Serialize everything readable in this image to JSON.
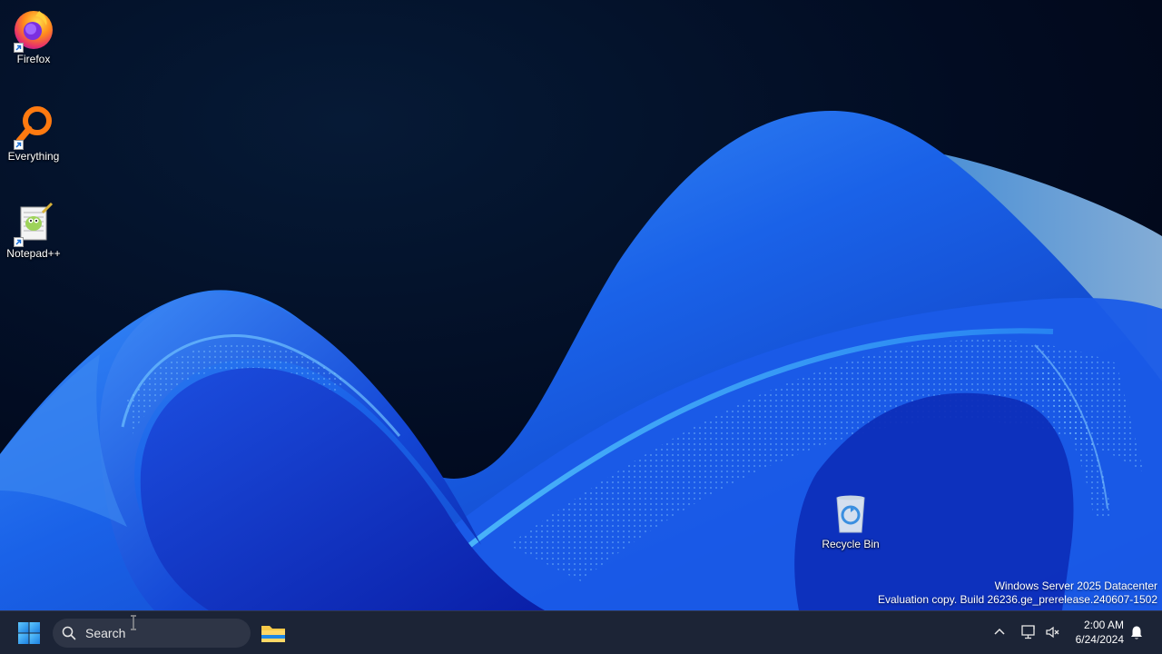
{
  "desktop": {
    "icons": [
      {
        "label": "Firefox",
        "icon": "firefox-icon"
      },
      {
        "label": "Everything",
        "icon": "everything-search-icon"
      },
      {
        "label": "Notepad++",
        "icon": "notepad-plus-plus-icon"
      },
      {
        "label": "Recycle Bin",
        "icon": "recycle-bin-icon"
      }
    ],
    "watermark": {
      "edition": "Windows Server 2025 Datacenter",
      "build": "Evaluation copy. Build 26236.ge_prerelease.240607-1502"
    }
  },
  "taskbar": {
    "start_icon": "windows-start-icon",
    "search": {
      "placeholder": "Search",
      "icon": "search-icon"
    },
    "pinned": [
      {
        "icon": "file-explorer-icon"
      }
    ],
    "tray": {
      "icons": [
        "show-hidden-icons-chevron",
        "network-icon",
        "volume-muted-icon"
      ],
      "time": "2:00 AM",
      "date": "6/24/2024",
      "notification_icon": "notification-bell-icon"
    }
  },
  "colors": {
    "wallpaper_dark": "#020a1e",
    "wallpaper_blue": "#1f5ee6",
    "taskbar_bg": "#1c2436",
    "accent": "#0078d4"
  }
}
